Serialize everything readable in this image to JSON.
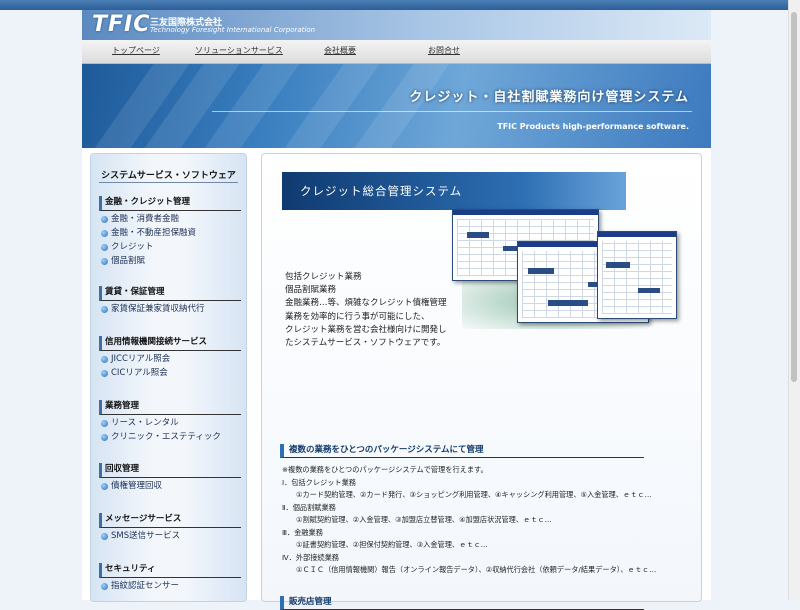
{
  "logo": {
    "mark": "TFIC",
    "jp": "三友国際株式会社",
    "en": "Technology Foresight International Corporation"
  },
  "nav": [
    {
      "label": "トップページ"
    },
    {
      "label": "ソリューションサービス"
    },
    {
      "label": "会社概要"
    },
    {
      "label": "お問合せ"
    }
  ],
  "hero": {
    "title": "クレジット・自社割賦業務向け管理システム",
    "tagline": "TFIC Products high-performance software."
  },
  "sidebar": {
    "title": "システムサービス・ソフトウェア",
    "sections": [
      {
        "heading": "金融・クレジット管理",
        "items": [
          "金融・消費者金融",
          "金融・不動産担保融資",
          "クレジット",
          "個品割賦"
        ]
      },
      {
        "heading": "賃貸・保証管理",
        "items": [
          "家賃保証兼家賃収納代行"
        ]
      },
      {
        "heading": "信用情報機関接続サービス",
        "items": [
          "JICCリアル照会",
          "CICリアル照会"
        ]
      },
      {
        "heading": "業務管理",
        "items": [
          "リース・レンタル",
          "クリニック・エステティック"
        ]
      },
      {
        "heading": "回収管理",
        "items": [
          "債権管理回収"
        ]
      },
      {
        "heading": "メッセージサービス",
        "items": [
          "SMS送信サービス"
        ]
      },
      {
        "heading": "セキュリティ",
        "items": [
          "指紋認証センサー"
        ]
      }
    ]
  },
  "main": {
    "banner": "クレジット総合管理システム",
    "intro": [
      "包括クレジット業務",
      "個品割賦業務",
      "金融業務…等、煩雑なクレジット債権管理",
      "業務を効率的に行う事が可能にした、",
      "クレジット業務を営む会社様向けに開発し",
      "たシステムサービス・ソフトウェアです。"
    ],
    "section1": "複数の業務をひとつのパッケージシステムにて管理",
    "details": [
      {
        "text": "※複数の業務をひとつのパッケージシステムで管理を行えます。",
        "indent": false
      },
      {
        "text": "Ⅰ．包括クレジット業務",
        "indent": false
      },
      {
        "text": "①カード契約管理、②カード発行、③ショッピング利用管理、④キャッシング利用管理、⑤入金管理、ｅｔｃ…",
        "indent": true
      },
      {
        "text": "Ⅱ．個品割賦業務",
        "indent": false
      },
      {
        "text": "①割賦契約管理、②入金管理、③加盟店立替管理、④加盟店状況管理、ｅｔｃ…",
        "indent": true
      },
      {
        "text": "Ⅲ．金融業務",
        "indent": false
      },
      {
        "text": "①証書契約管理、②担保付契約管理、③入金管理、ｅｔｃ…",
        "indent": true
      },
      {
        "text": "Ⅳ．外部接続業務",
        "indent": false
      },
      {
        "text": "①ＣＩＣ（信用情報機関）報告（オンライン報告データ）、②収納代行会社（依頼データ/結果データ）、ｅｔｃ…",
        "indent": true
      }
    ],
    "section2": "販売店管理"
  },
  "colors": {
    "accent": "#2d6fb3",
    "link": "#1c2f55",
    "heading": "#153a6b"
  }
}
